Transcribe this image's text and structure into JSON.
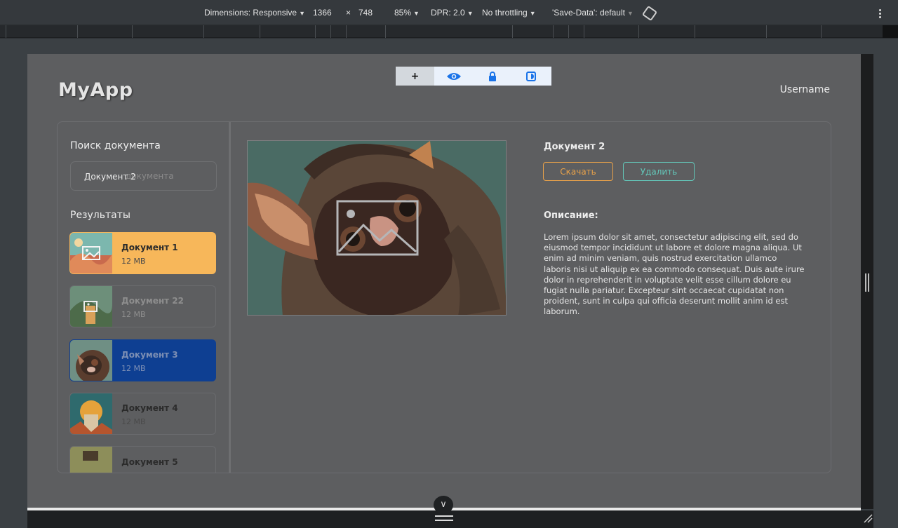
{
  "devtools": {
    "dimensions_label": "Dimensions: Responsive",
    "width": "1366",
    "times": "×",
    "height": "748",
    "zoom": "85%",
    "dpr": "DPR: 2.0",
    "throttling": "No throttling",
    "save_data": "'Save-Data': default"
  },
  "app": {
    "logo": "MyApp",
    "username": "Username",
    "toolbar": {
      "add": "+"
    }
  },
  "sidebar": {
    "search_label": "Поиск документа",
    "search_value": "Документ 2",
    "search_placeholder": "документа",
    "results_label": "Результаты",
    "items": [
      {
        "name": "Документ 1",
        "size": "12 MB"
      },
      {
        "name": "Документ 22",
        "size": "12 MB"
      },
      {
        "name": "Документ 3",
        "size": "12 MB"
      },
      {
        "name": "Документ 4",
        "size": "12 MB"
      },
      {
        "name": "Документ 5",
        "size": ""
      }
    ]
  },
  "document": {
    "title": "Документ 2",
    "download_label": "Скачать",
    "delete_label": "Удалить",
    "description_label": "Описание:",
    "description": "Lorem ipsum dolor sit amet, consectetur adipiscing elit, sed do eiusmod tempor incididunt ut labore et dolore magna aliqua. Ut enim ad minim veniam, quis nostrud exercitation ullamco laboris nisi ut aliquip ex ea commodo consequat. Duis aute irure dolor in reprehenderit in voluptate velit esse cillum dolore eu fugiat nulla pariatur. Excepteur sint occaecat cupidatat non proident, sunt in culpa qui officia deserunt mollit anim id est laborum."
  },
  "colors": {
    "selected_primary": "#f7b75a",
    "selected_secondary": "#0e3f92",
    "download_accent": "#e8a24a",
    "delete_accent": "#63c7b9"
  }
}
